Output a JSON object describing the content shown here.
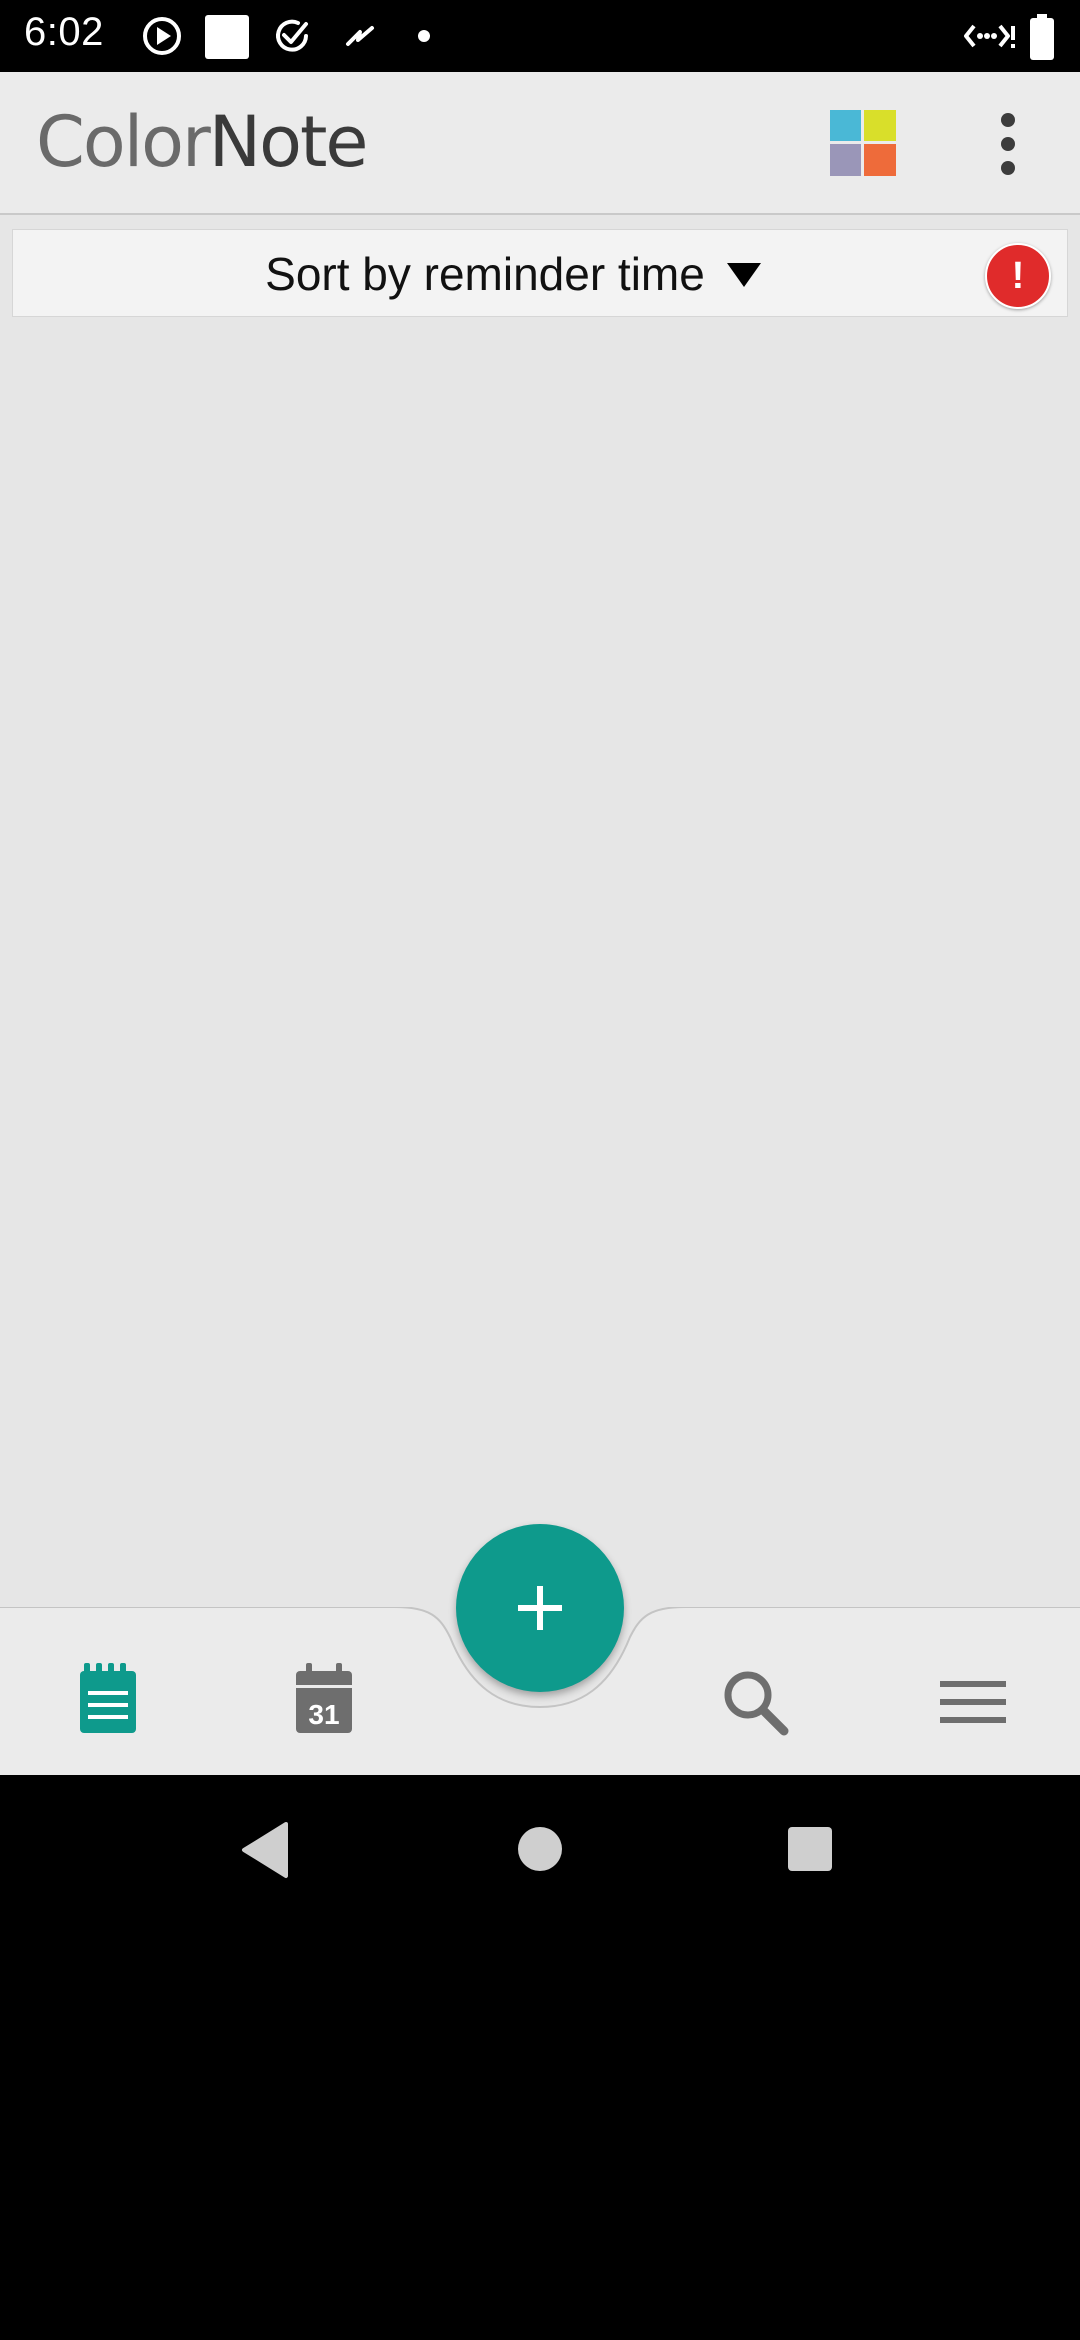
{
  "status_bar": {
    "time": "6:02",
    "icons": [
      "play-circle-icon",
      "white-square-icon",
      "check-circle-icon",
      "squiggle-icon",
      "dot-icon",
      "wifi-data-icon",
      "battery-icon"
    ]
  },
  "app_bar": {
    "logo_text_1": "Color",
    "logo_text_2": "Note",
    "color_grid": [
      "#4ab8d6",
      "#d9df2a",
      "#9a96b8",
      "#ee6b3a"
    ]
  },
  "sort_bar": {
    "label": "Sort by reminder time",
    "alert_symbol": "!"
  },
  "bottom_nav": {
    "items": [
      "notes-icon",
      "calendar-icon",
      "search-icon",
      "menu-icon"
    ],
    "calendar_day": "31",
    "active_color": "#0e9a8c",
    "inactive_color": "#6e6e6e",
    "fab_icon": "plus-icon"
  },
  "system_nav": {
    "buttons": [
      "back-icon",
      "home-icon",
      "recents-icon"
    ]
  }
}
